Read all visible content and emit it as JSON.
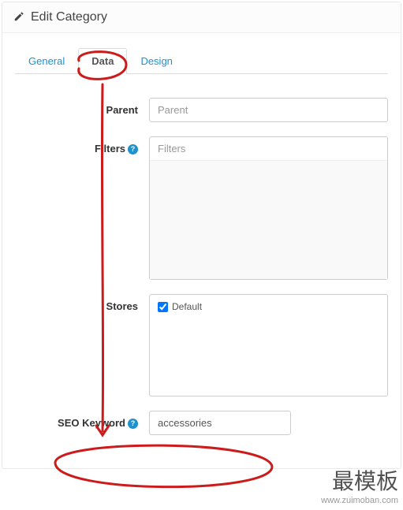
{
  "header": {
    "title": "Edit Category"
  },
  "tabs": {
    "general": "General",
    "data": "Data",
    "design": "Design"
  },
  "form": {
    "parent": {
      "label": "Parent",
      "placeholder": "Parent",
      "value": ""
    },
    "filters": {
      "label": "Filters",
      "placeholder": "Filters"
    },
    "stores": {
      "label": "Stores",
      "default_label": "Default"
    },
    "seo": {
      "label": "SEO Keyword",
      "value": "accessories"
    }
  },
  "watermark": {
    "cn": "最模板",
    "url": "www.zuimoban.com"
  }
}
